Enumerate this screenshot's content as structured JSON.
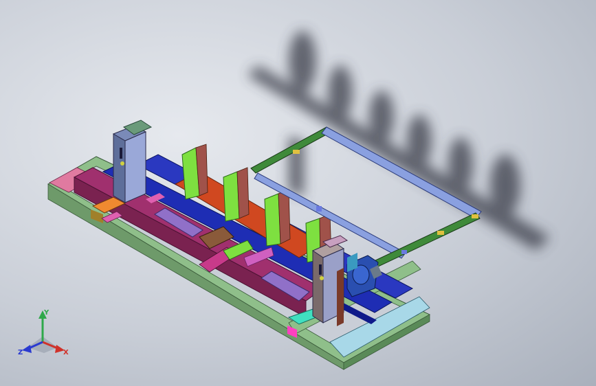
{
  "window": {
    "background_top": "#e6e9ee",
    "background_bottom": "#a9b0bc"
  },
  "model": {
    "colors": {
      "frame_outer": "#8fbf8a",
      "frame_pink": "#e07aa0",
      "rail_blue": "#1e2db4",
      "rail_magenta": "#a0306e",
      "column_steel": "#5e6e9a",
      "column_panel": "#9aa8d8",
      "support_green": "#7ee040",
      "support_brown": "#a0524a",
      "beam_red": "#d04820",
      "conveyor_green": "#3f8a3a",
      "conveyor_blue": "#8aa0e0",
      "motor_blue": "#2a4fb0",
      "cylinder_purple": "#9070c8",
      "cylinder_brown": "#8a5a3a",
      "orange_block": "#f08a30",
      "cyan_block": "#40e0c0",
      "shadow": "#3a3e48"
    }
  },
  "triad": {
    "y_label": "Y",
    "x_label": "X",
    "z_label": "Z",
    "y_color": "#2ea84a",
    "x_color": "#d0322a",
    "z_color": "#2a3ad0"
  }
}
